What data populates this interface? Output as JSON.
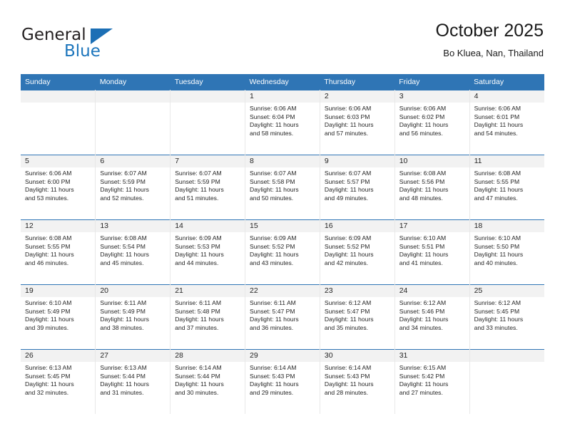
{
  "logo": {
    "word_top": "General",
    "word_bottom": "Blue",
    "triangle_icon": "blue-triangle-icon",
    "accent_color": "#1c75bc"
  },
  "header": {
    "title": "October 2025",
    "subtitle": "Bo Kluea, Nan, Thailand"
  },
  "theme": {
    "header_bg": "#2f75b5",
    "header_text": "#ffffff",
    "daynum_bg": "#f2f2f2",
    "row_rule": "#2f75b5"
  },
  "weekdays": [
    "Sunday",
    "Monday",
    "Tuesday",
    "Wednesday",
    "Thursday",
    "Friday",
    "Saturday"
  ],
  "labels": {
    "sunrise_prefix": "Sunrise:",
    "sunset_prefix": "Sunset:",
    "daylight_prefix": "Daylight:"
  },
  "weeks": [
    [
      {
        "day": "",
        "sunrise": "",
        "sunset": "",
        "daylight_line1": "",
        "daylight_line2": "",
        "empty": true
      },
      {
        "day": "",
        "sunrise": "",
        "sunset": "",
        "daylight_line1": "",
        "daylight_line2": "",
        "empty": true
      },
      {
        "day": "",
        "sunrise": "",
        "sunset": "",
        "daylight_line1": "",
        "daylight_line2": "",
        "empty": true
      },
      {
        "day": "1",
        "sunrise": "Sunrise: 6:06 AM",
        "sunset": "Sunset: 6:04 PM",
        "daylight_line1": "Daylight: 11 hours",
        "daylight_line2": "and 58 minutes."
      },
      {
        "day": "2",
        "sunrise": "Sunrise: 6:06 AM",
        "sunset": "Sunset: 6:03 PM",
        "daylight_line1": "Daylight: 11 hours",
        "daylight_line2": "and 57 minutes."
      },
      {
        "day": "3",
        "sunrise": "Sunrise: 6:06 AM",
        "sunset": "Sunset: 6:02 PM",
        "daylight_line1": "Daylight: 11 hours",
        "daylight_line2": "and 56 minutes."
      },
      {
        "day": "4",
        "sunrise": "Sunrise: 6:06 AM",
        "sunset": "Sunset: 6:01 PM",
        "daylight_line1": "Daylight: 11 hours",
        "daylight_line2": "and 54 minutes."
      }
    ],
    [
      {
        "day": "5",
        "sunrise": "Sunrise: 6:06 AM",
        "sunset": "Sunset: 6:00 PM",
        "daylight_line1": "Daylight: 11 hours",
        "daylight_line2": "and 53 minutes."
      },
      {
        "day": "6",
        "sunrise": "Sunrise: 6:07 AM",
        "sunset": "Sunset: 5:59 PM",
        "daylight_line1": "Daylight: 11 hours",
        "daylight_line2": "and 52 minutes."
      },
      {
        "day": "7",
        "sunrise": "Sunrise: 6:07 AM",
        "sunset": "Sunset: 5:59 PM",
        "daylight_line1": "Daylight: 11 hours",
        "daylight_line2": "and 51 minutes."
      },
      {
        "day": "8",
        "sunrise": "Sunrise: 6:07 AM",
        "sunset": "Sunset: 5:58 PM",
        "daylight_line1": "Daylight: 11 hours",
        "daylight_line2": "and 50 minutes."
      },
      {
        "day": "9",
        "sunrise": "Sunrise: 6:07 AM",
        "sunset": "Sunset: 5:57 PM",
        "daylight_line1": "Daylight: 11 hours",
        "daylight_line2": "and 49 minutes."
      },
      {
        "day": "10",
        "sunrise": "Sunrise: 6:08 AM",
        "sunset": "Sunset: 5:56 PM",
        "daylight_line1": "Daylight: 11 hours",
        "daylight_line2": "and 48 minutes."
      },
      {
        "day": "11",
        "sunrise": "Sunrise: 6:08 AM",
        "sunset": "Sunset: 5:55 PM",
        "daylight_line1": "Daylight: 11 hours",
        "daylight_line2": "and 47 minutes."
      }
    ],
    [
      {
        "day": "12",
        "sunrise": "Sunrise: 6:08 AM",
        "sunset": "Sunset: 5:55 PM",
        "daylight_line1": "Daylight: 11 hours",
        "daylight_line2": "and 46 minutes."
      },
      {
        "day": "13",
        "sunrise": "Sunrise: 6:08 AM",
        "sunset": "Sunset: 5:54 PM",
        "daylight_line1": "Daylight: 11 hours",
        "daylight_line2": "and 45 minutes."
      },
      {
        "day": "14",
        "sunrise": "Sunrise: 6:09 AM",
        "sunset": "Sunset: 5:53 PM",
        "daylight_line1": "Daylight: 11 hours",
        "daylight_line2": "and 44 minutes."
      },
      {
        "day": "15",
        "sunrise": "Sunrise: 6:09 AM",
        "sunset": "Sunset: 5:52 PM",
        "daylight_line1": "Daylight: 11 hours",
        "daylight_line2": "and 43 minutes."
      },
      {
        "day": "16",
        "sunrise": "Sunrise: 6:09 AM",
        "sunset": "Sunset: 5:52 PM",
        "daylight_line1": "Daylight: 11 hours",
        "daylight_line2": "and 42 minutes."
      },
      {
        "day": "17",
        "sunrise": "Sunrise: 6:10 AM",
        "sunset": "Sunset: 5:51 PM",
        "daylight_line1": "Daylight: 11 hours",
        "daylight_line2": "and 41 minutes."
      },
      {
        "day": "18",
        "sunrise": "Sunrise: 6:10 AM",
        "sunset": "Sunset: 5:50 PM",
        "daylight_line1": "Daylight: 11 hours",
        "daylight_line2": "and 40 minutes."
      }
    ],
    [
      {
        "day": "19",
        "sunrise": "Sunrise: 6:10 AM",
        "sunset": "Sunset: 5:49 PM",
        "daylight_line1": "Daylight: 11 hours",
        "daylight_line2": "and 39 minutes."
      },
      {
        "day": "20",
        "sunrise": "Sunrise: 6:11 AM",
        "sunset": "Sunset: 5:49 PM",
        "daylight_line1": "Daylight: 11 hours",
        "daylight_line2": "and 38 minutes."
      },
      {
        "day": "21",
        "sunrise": "Sunrise: 6:11 AM",
        "sunset": "Sunset: 5:48 PM",
        "daylight_line1": "Daylight: 11 hours",
        "daylight_line2": "and 37 minutes."
      },
      {
        "day": "22",
        "sunrise": "Sunrise: 6:11 AM",
        "sunset": "Sunset: 5:47 PM",
        "daylight_line1": "Daylight: 11 hours",
        "daylight_line2": "and 36 minutes."
      },
      {
        "day": "23",
        "sunrise": "Sunrise: 6:12 AM",
        "sunset": "Sunset: 5:47 PM",
        "daylight_line1": "Daylight: 11 hours",
        "daylight_line2": "and 35 minutes."
      },
      {
        "day": "24",
        "sunrise": "Sunrise: 6:12 AM",
        "sunset": "Sunset: 5:46 PM",
        "daylight_line1": "Daylight: 11 hours",
        "daylight_line2": "and 34 minutes."
      },
      {
        "day": "25",
        "sunrise": "Sunrise: 6:12 AM",
        "sunset": "Sunset: 5:45 PM",
        "daylight_line1": "Daylight: 11 hours",
        "daylight_line2": "and 33 minutes."
      }
    ],
    [
      {
        "day": "26",
        "sunrise": "Sunrise: 6:13 AM",
        "sunset": "Sunset: 5:45 PM",
        "daylight_line1": "Daylight: 11 hours",
        "daylight_line2": "and 32 minutes."
      },
      {
        "day": "27",
        "sunrise": "Sunrise: 6:13 AM",
        "sunset": "Sunset: 5:44 PM",
        "daylight_line1": "Daylight: 11 hours",
        "daylight_line2": "and 31 minutes."
      },
      {
        "day": "28",
        "sunrise": "Sunrise: 6:14 AM",
        "sunset": "Sunset: 5:44 PM",
        "daylight_line1": "Daylight: 11 hours",
        "daylight_line2": "and 30 minutes."
      },
      {
        "day": "29",
        "sunrise": "Sunrise: 6:14 AM",
        "sunset": "Sunset: 5:43 PM",
        "daylight_line1": "Daylight: 11 hours",
        "daylight_line2": "and 29 minutes."
      },
      {
        "day": "30",
        "sunrise": "Sunrise: 6:14 AM",
        "sunset": "Sunset: 5:43 PM",
        "daylight_line1": "Daylight: 11 hours",
        "daylight_line2": "and 28 minutes."
      },
      {
        "day": "31",
        "sunrise": "Sunrise: 6:15 AM",
        "sunset": "Sunset: 5:42 PM",
        "daylight_line1": "Daylight: 11 hours",
        "daylight_line2": "and 27 minutes."
      },
      {
        "day": "",
        "sunrise": "",
        "sunset": "",
        "daylight_line1": "",
        "daylight_line2": "",
        "empty": true
      }
    ]
  ]
}
